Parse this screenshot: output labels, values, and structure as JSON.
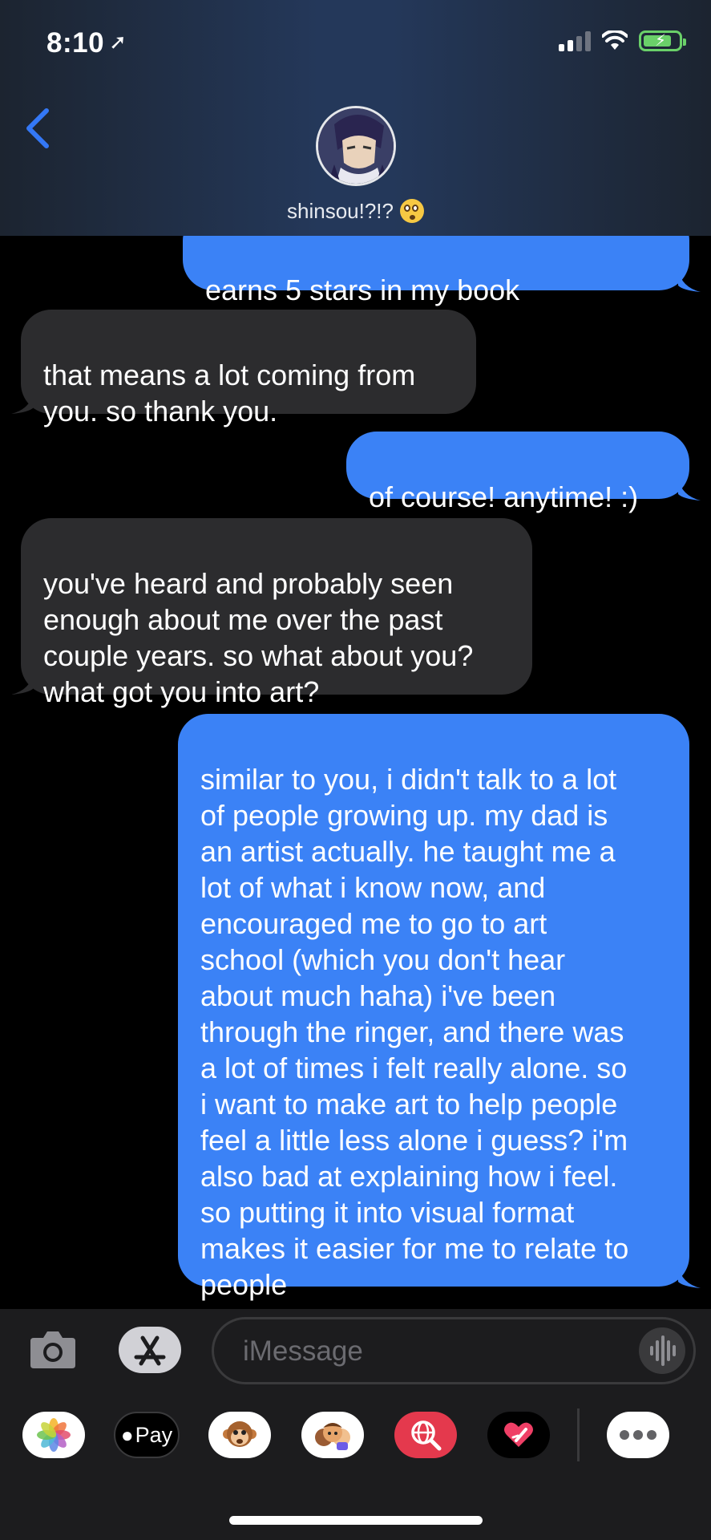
{
  "status_bar": {
    "time": "8:10"
  },
  "header": {
    "contact_name": "shinsou!?!?",
    "contact_emoji": "flushed-face-emoji"
  },
  "messages": [
    {
      "direction": "sent",
      "text": "earns 5 stars in my book"
    },
    {
      "direction": "received",
      "text": "that means a lot coming from\nyou. so thank you."
    },
    {
      "direction": "sent",
      "text": "of course! anytime! :)"
    },
    {
      "direction": "received",
      "text": "you've heard and probably seen\nenough about me over the past\ncouple years. so what about you?\nwhat got you into art?"
    },
    {
      "direction": "sent",
      "text": "similar to you, i didn't talk to a lot\nof people growing up. my dad is\nan artist actually. he taught me a\nlot of what i know now, and\nencouraged me to go to art\nschool (which you don't hear\nabout much haha) i've been\nthrough the ringer, and there was\na lot of times i felt really alone. so\ni want to make art to help people\nfeel a little less alone i guess? i'm\nalso bad at explaining how i feel.\nso putting it into visual format\nmakes it easier for me to relate to\npeople"
    }
  ],
  "composer": {
    "placeholder": "iMessage"
  },
  "app_drawer": {
    "apple_pay_label": "Pay"
  },
  "colors": {
    "sent_bubble": "#3b82f6",
    "received_bubble": "#2c2c2e",
    "accent": "#3478f6",
    "battery": "#6ad069"
  }
}
